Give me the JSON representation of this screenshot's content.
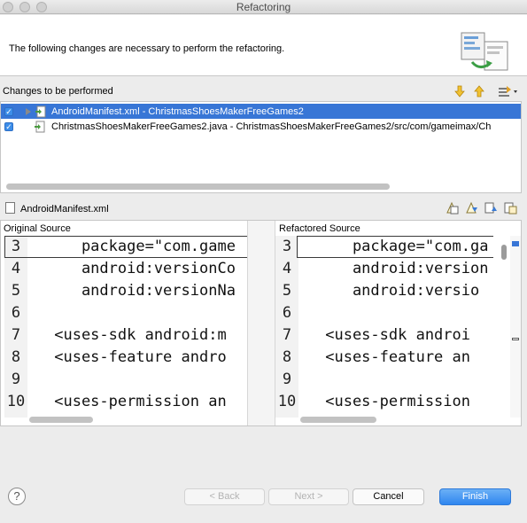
{
  "window": {
    "title": "Refactoring"
  },
  "header": {
    "message": "The following changes are necessary to perform the refactoring."
  },
  "changes": {
    "label": "Changes to be performed",
    "items": [
      {
        "label": "AndroidManifest.xml - ChristmasShoesMakerFreeGames2",
        "checked": true,
        "selected": true
      },
      {
        "label": "ChristmasShoesMakerFreeGames2.java - ChristmasShoesMakerFreeGames2/src/com/gameimax/Ch",
        "checked": true,
        "selected": false
      }
    ]
  },
  "diff": {
    "file_name": "AndroidManifest.xml",
    "original_label": "Original Source",
    "refactored_label": "Refactored Source",
    "original_lines": [
      {
        "num": "3",
        "text": "    package=\"com.game"
      },
      {
        "num": "4",
        "text": "    android:versionCo"
      },
      {
        "num": "5",
        "text": "    android:versionNa"
      },
      {
        "num": "6",
        "text": ""
      },
      {
        "num": "7",
        "text": " <uses-sdk android:m"
      },
      {
        "num": "8",
        "text": " <uses-feature andro"
      },
      {
        "num": "9",
        "text": ""
      },
      {
        "num": "10",
        "text": " <uses-permission an"
      }
    ],
    "refactored_lines": [
      {
        "num": "3",
        "text": "    package=\"com.ga"
      },
      {
        "num": "4",
        "text": "    android:version"
      },
      {
        "num": "5",
        "text": "    android:versio"
      },
      {
        "num": "6",
        "text": ""
      },
      {
        "num": "7",
        "text": " <uses-sdk androi"
      },
      {
        "num": "8",
        "text": " <uses-feature an"
      },
      {
        "num": "9",
        "text": ""
      },
      {
        "num": "10",
        "text": " <uses-permission"
      }
    ]
  },
  "buttons": {
    "help": "?",
    "back": "< Back",
    "next": "Next >",
    "cancel": "Cancel",
    "finish": "Finish"
  },
  "colors": {
    "selection": "#3876d6",
    "primary_button": "#2f86ef"
  }
}
